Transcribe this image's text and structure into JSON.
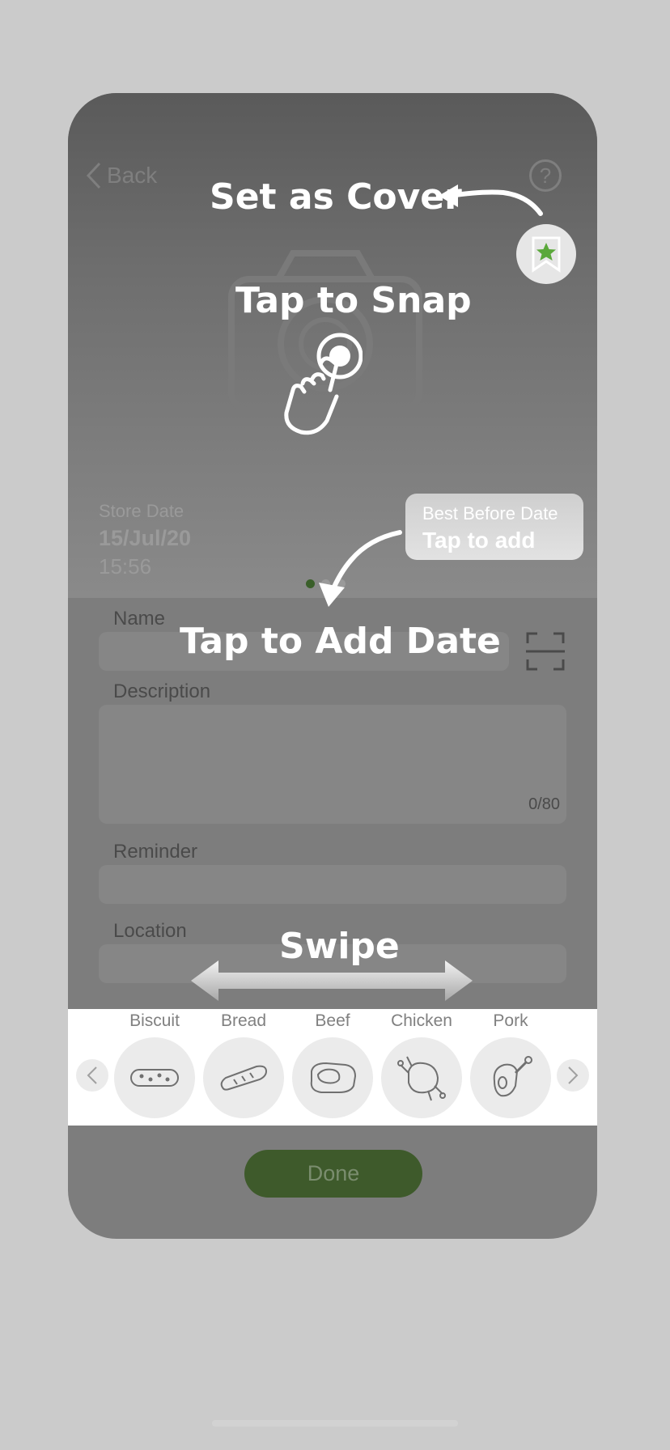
{
  "header": {
    "back_label": "Back",
    "help_glyph": "?"
  },
  "icons": {
    "back": "chevron-left-icon",
    "help": "question-circle-icon",
    "camera": "camera-icon",
    "cover": "bookmark-star-icon",
    "scan": "barcode-scan-icon",
    "tap": "tap-hand-icon"
  },
  "hero": {
    "store_date_label": "Store Date",
    "store_date": "15/Jul/20",
    "store_time": "15:56",
    "best_before_label": "Best Before Date",
    "best_before_action": "Tap to add"
  },
  "form": {
    "name_label": "Name",
    "description_label": "Description",
    "description_counter": "0/80",
    "reminder_label": "Reminder",
    "location_label": "Location"
  },
  "categories": [
    {
      "label": "Biscuit",
      "icon": "biscuit-icon"
    },
    {
      "label": "Bread",
      "icon": "bread-icon"
    },
    {
      "label": "Beef",
      "icon": "beef-icon"
    },
    {
      "label": "Chicken",
      "icon": "chicken-icon"
    },
    {
      "label": "Pork",
      "icon": "pork-icon"
    }
  ],
  "done_label": "Done",
  "tutorial": {
    "set_as_cover": "Set as Cover",
    "tap_to_snap": "Tap to Snap",
    "tap_to_add_date": "Tap to Add Date",
    "swipe": "Swipe"
  },
  "colors": {
    "accent_green": "#3e5a2b",
    "star_green": "#5aa83a",
    "background": "#cbcbcb"
  }
}
